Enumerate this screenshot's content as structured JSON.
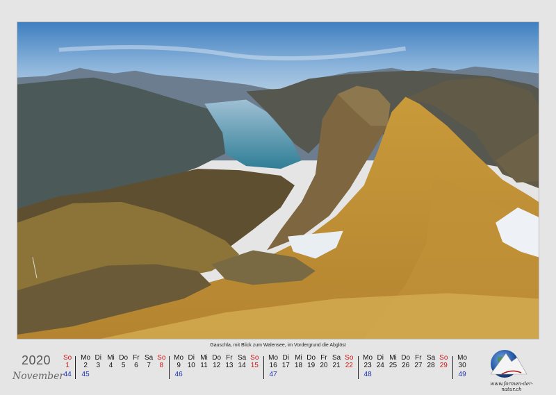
{
  "photo": {
    "subject": "mountain-landscape"
  },
  "caption": "Gauschla, mit Blick zum Walensee, im Vordergrund die Abglöst",
  "calendar": {
    "year": "2020",
    "month": "November",
    "weeks": [
      {
        "week": "44",
        "days": [
          {
            "name": "So",
            "num": "1",
            "sunday": true
          }
        ]
      },
      {
        "week": "45",
        "days": [
          {
            "name": "Mo",
            "num": "2"
          },
          {
            "name": "Di",
            "num": "3"
          },
          {
            "name": "Mi",
            "num": "4"
          },
          {
            "name": "Do",
            "num": "5"
          },
          {
            "name": "Fr",
            "num": "6"
          },
          {
            "name": "Sa",
            "num": "7"
          },
          {
            "name": "So",
            "num": "8",
            "sunday": true
          }
        ]
      },
      {
        "week": "46",
        "days": [
          {
            "name": "Mo",
            "num": "9"
          },
          {
            "name": "Di",
            "num": "10"
          },
          {
            "name": "Mi",
            "num": "11"
          },
          {
            "name": "Do",
            "num": "12"
          },
          {
            "name": "Fr",
            "num": "13"
          },
          {
            "name": "Sa",
            "num": "14"
          },
          {
            "name": "So",
            "num": "15",
            "sunday": true
          }
        ]
      },
      {
        "week": "47",
        "days": [
          {
            "name": "Mo",
            "num": "16"
          },
          {
            "name": "Di",
            "num": "17"
          },
          {
            "name": "Mi",
            "num": "18"
          },
          {
            "name": "Do",
            "num": "19"
          },
          {
            "name": "Fr",
            "num": "20"
          },
          {
            "name": "Sa",
            "num": "21"
          },
          {
            "name": "So",
            "num": "22",
            "sunday": true
          }
        ]
      },
      {
        "week": "48",
        "days": [
          {
            "name": "Mo",
            "num": "23"
          },
          {
            "name": "Di",
            "num": "24"
          },
          {
            "name": "Mi",
            "num": "25"
          },
          {
            "name": "Do",
            "num": "26"
          },
          {
            "name": "Fr",
            "num": "27"
          },
          {
            "name": "Sa",
            "num": "28"
          },
          {
            "name": "So",
            "num": "29",
            "sunday": true
          }
        ]
      },
      {
        "week": "49",
        "days": [
          {
            "name": "Mo",
            "num": "30"
          }
        ]
      }
    ]
  },
  "logo": {
    "url_text": "www.formen-der-natur.ch",
    "icon": "globe-mountain-logo"
  },
  "colors": {
    "sunday": "#d01818",
    "week_number": "#1c2fb0",
    "background": "#e5e5e5"
  }
}
